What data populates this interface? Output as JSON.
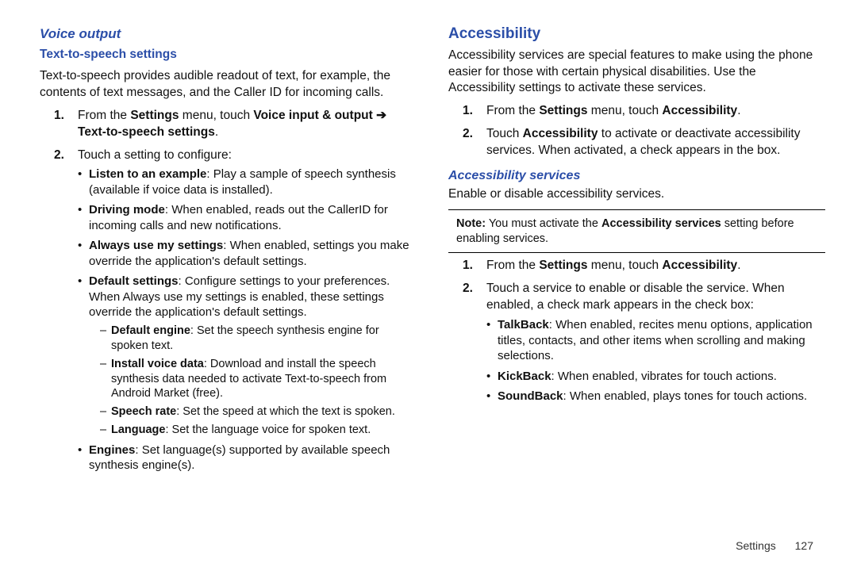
{
  "left": {
    "voice_output": "Voice output",
    "tts_heading": "Text-to-speech settings",
    "tts_intro": "Text-to-speech provides audible readout of text, for example, the contents of text messages, and the Caller ID for incoming calls.",
    "step1_a": "From the ",
    "step1_b": "Settings",
    "step1_c": " menu, touch ",
    "step1_d": "Voice input & output",
    "step1_e": " ➔ ",
    "step1_f": "Text-to-speech settings",
    "step1_g": ".",
    "step2": "Touch a setting to configure:",
    "b1_h": "Listen to an example",
    "b1_t": ": Play a sample of speech synthesis (available if voice data is installed).",
    "b2_h": "Driving mode",
    "b2_t": ": When enabled, reads out the CallerID for incoming calls and new notifications.",
    "b3_h": "Always use my settings",
    "b3_t": ": When enabled, settings you make override the application's default settings.",
    "b4_h": "Default settings",
    "b4_t": ": Configure settings to your preferences. When Always use my settings is enabled, these settings override the application's default settings.",
    "d1_h": "Default engine",
    "d1_t": ": Set the speech synthesis engine for spoken text.",
    "d2_h": "Install voice data",
    "d2_t": ": Download and install the speech synthesis data needed to activate Text-to-speech from Android Market (free).",
    "d3_h": "Speech rate",
    "d3_t": ": Set the speed at which the text is spoken.",
    "d4_h": "Language",
    "d4_t": ": Set the language voice for spoken text.",
    "b5_h": "Engines",
    "b5_t": ": Set language(s) supported by available speech synthesis engine(s)."
  },
  "right": {
    "access_heading": "Accessibility",
    "access_intro": "Accessibility services are special features to make using the phone easier for those with certain physical disabilities. Use the Accessibility settings to activate these services.",
    "a1_a": "From the ",
    "a1_b": "Settings",
    "a1_c": " menu, touch ",
    "a1_d": "Accessibility",
    "a1_e": ".",
    "a2_a": "Touch ",
    "a2_b": "Accessibility",
    "a2_c": " to activate or deactivate accessibility services. When activated, a check appears in the box.",
    "services_heading": "Accessibility services",
    "services_intro": "Enable or disable accessibility services.",
    "note_a": "Note:",
    "note_b": " You must activate the ",
    "note_c": "Accessibility services",
    "note_d": " setting before enabling services.",
    "s1_a": "From the ",
    "s1_b": "Settings",
    "s1_c": " menu, touch ",
    "s1_d": "Accessibility",
    "s1_e": ".",
    "s2": "Touch a service to enable or disable the service. When enabled, a check mark appears in the check box:",
    "sb1_h": "TalkBack",
    "sb1_t": ": When enabled, recites menu options, application titles, contacts, and other items when scrolling and making selections.",
    "sb2_h": "KickBack",
    "sb2_t": ": When enabled, vibrates for touch actions.",
    "sb3_h": "SoundBack",
    "sb3_t": ": When enabled, plays tones for touch actions."
  },
  "footer": {
    "section": "Settings",
    "page": "127"
  }
}
